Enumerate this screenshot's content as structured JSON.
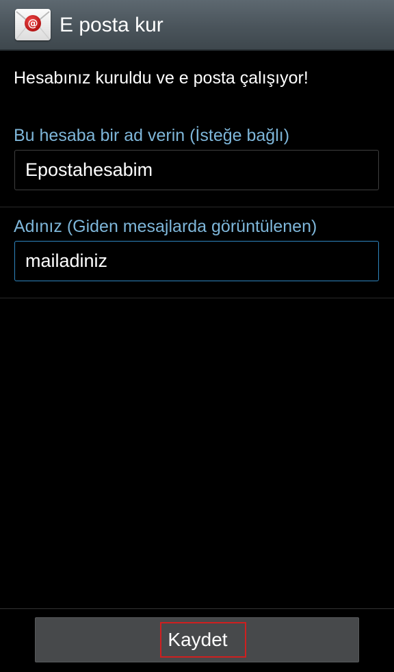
{
  "action_bar": {
    "icon": "email-app-icon",
    "title": "E posta kur"
  },
  "message": "Hesabınız kuruldu ve e posta çalışıyor!",
  "fields": [
    {
      "label": "Bu hesaba bir ad verin (İsteğe bağlı)",
      "value": "Epostahesabim",
      "focused": false
    },
    {
      "label": "Adınız (Giden mesajlarda görüntülenen)",
      "value": "mailadiniz",
      "focused": true
    }
  ],
  "footer": {
    "save_label": "Kaydet",
    "highlight_color": "#d01f1f"
  },
  "colors": {
    "label": "#7eb6d9",
    "focus_border": "#2f86c0",
    "action_bar": "#4a545b"
  }
}
